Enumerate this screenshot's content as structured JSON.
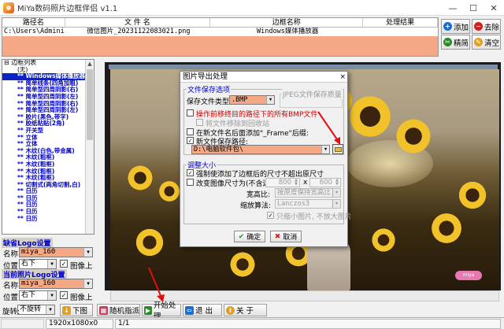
{
  "window": {
    "title": "MiYa数码照片边框伴侣 v1.1",
    "controls": [
      "—",
      "☐",
      "✕"
    ]
  },
  "filelist": {
    "headers": [
      "路径名",
      "文 件 名",
      "边框名称",
      "处理结果"
    ],
    "rows": [
      {
        "path": "C:\\Users\\Admini...",
        "name": "微信图片_20231122083021.png",
        "frame": "Windows媒体播放器",
        "result": ""
      }
    ]
  },
  "side_buttons": {
    "add": "添加",
    "remove": "去除",
    "clean": "精简",
    "clear": "清空"
  },
  "tree": {
    "root": "边框列表",
    "items": [
      "(无)",
      "** Windows媒体播放器",
      "** 简单线条(四角加粗)",
      "** 简单型四周阴影(右)",
      "** 简单型四周阴影(左)",
      "** 简单型四周阴影(右)",
      "** 简单型四周阴影(左)",
      "** 胶片(黑色,带字)",
      "** 胶纸粘贴(2角)",
      "** 开关型",
      "** 立体",
      "** 立体",
      "** 木纹(白色,带金属)",
      "** 木纹(粗框)",
      "** 木纹(粗框)",
      "** 木纹(粗框)",
      "** 木纹(粗框)",
      "** 切割式(两角切割,白)",
      "** 日历",
      "** 日历",
      "** 日历",
      "** 日历",
      "** 日历"
    ],
    "selected_index": 1
  },
  "logo_group": {
    "title": "缺省Logo设置",
    "name_label": "名称:",
    "name_value": "miya_160",
    "pos_label": "位置:",
    "pos_value": "右下",
    "on_image_label": "图像上",
    "on_image_checked": true
  },
  "cur_logo_group": {
    "title": "当前照片Logo设置",
    "name_label": "名称:",
    "name_value": "miya_160",
    "pos_label": "位置:",
    "pos_value": "右下",
    "on_image_label": "图像上",
    "on_image_checked": true
  },
  "rotate": {
    "label": "旋转:",
    "value": "不旋转"
  },
  "bottom_buttons": {
    "down": "下图",
    "random": "随机指派",
    "start": "开始处理",
    "exit": "退  出",
    "about": "关  于"
  },
  "status": {
    "resolution": "1920x1080x0",
    "page": "1/1"
  },
  "dialog": {
    "title": "图片导出处理",
    "close": "×",
    "save_group": "文件保存选项",
    "file_type_label": "保存文件类型:",
    "file_type_value": ".BMP",
    "jpeg_group": "JPEG文件保存质量",
    "opt_move": "操作前移终目的路径下的所有BMP文件",
    "opt_recycle": "将文件移除到回收站",
    "opt_suffix": "在新文件名后面添加\"_Frame\"后缀:",
    "opt_newpath": "新文件保存路径:",
    "newpath_checked": true,
    "path_value": "D:\\电脑软件包\\",
    "resize_group": "调整大小",
    "opt_force": "强制使添加了边框后的尺寸不超出原尺寸",
    "force_checked": true,
    "opt_change": "改变图像尺寸为(不含边框):",
    "width": "800",
    "height": "600",
    "times": "x",
    "aspect_label": "宽高比:",
    "aspect_value": "按原度保持宽高比",
    "algo_label": "缩放算法:",
    "algo_value": "Lanczos3",
    "opt_shrink": "只缩小图片, 不放大图片",
    "ok": "确定",
    "cancel": "取消"
  },
  "watermark": "miya"
}
